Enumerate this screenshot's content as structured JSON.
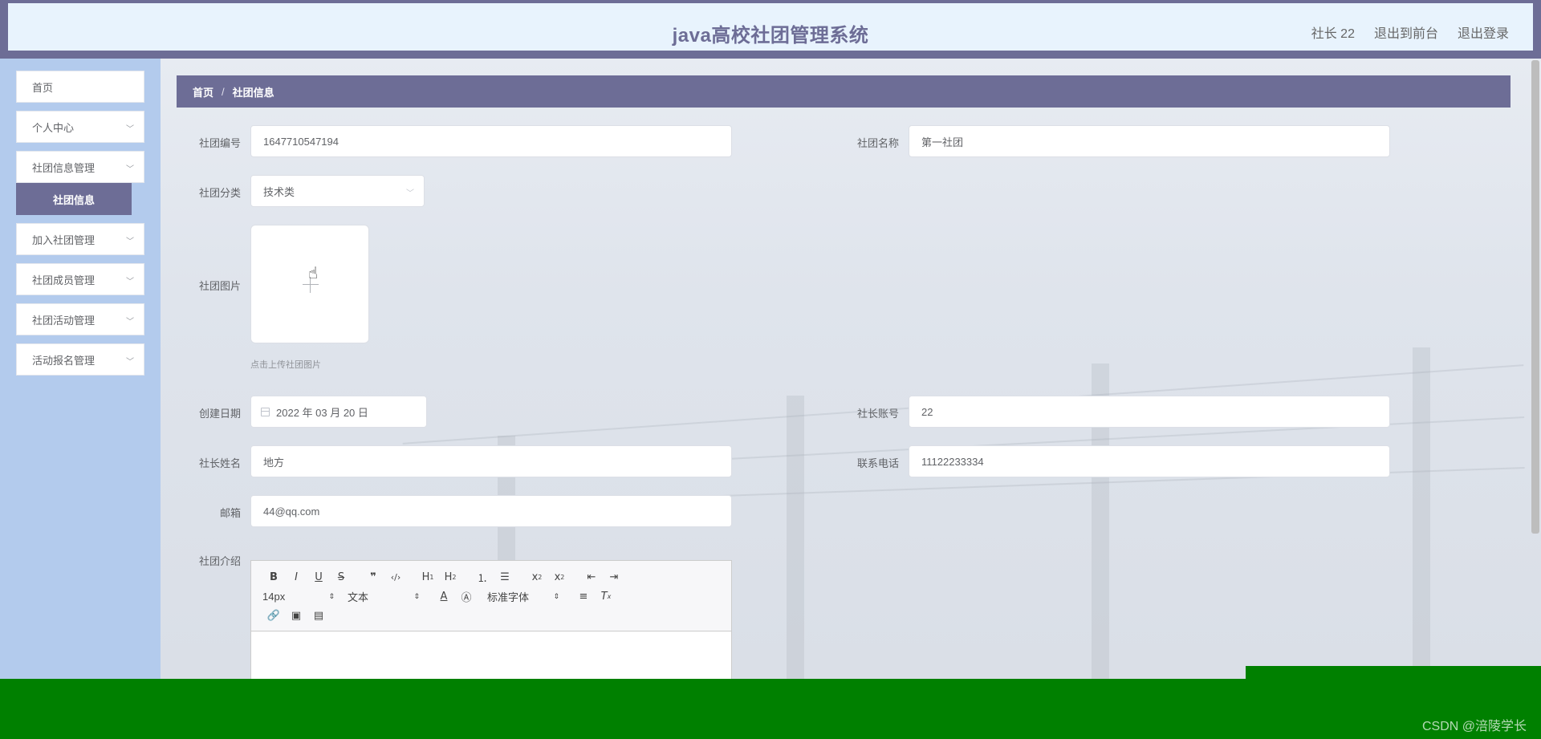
{
  "app": {
    "title": "java高校社团管理系统"
  },
  "header": {
    "user": "社长 22",
    "front_link": "退出到前台",
    "logout_link": "退出登录"
  },
  "sidebar": {
    "items": [
      {
        "label": "首页"
      },
      {
        "label": "个人中心"
      },
      {
        "label": "社团信息管理"
      },
      {
        "label": "社团信息",
        "active": true
      },
      {
        "label": "加入社团管理"
      },
      {
        "label": "社团成员管理"
      },
      {
        "label": "社团活动管理"
      },
      {
        "label": "活动报名管理"
      }
    ]
  },
  "breadcrumb": {
    "home": "首页",
    "separator": "/",
    "current": "社团信息"
  },
  "form": {
    "club_no": {
      "label": "社团编号",
      "value": "1647710547194"
    },
    "club_name": {
      "label": "社团名称",
      "value": "第一社团"
    },
    "club_category": {
      "label": "社团分类",
      "value": "技术类"
    },
    "club_image": {
      "label": "社团图片",
      "hint": "点击上传社团图片"
    },
    "created_date": {
      "label": "创建日期",
      "value": "2022 年 03 月 20 日"
    },
    "leader_account": {
      "label": "社长账号",
      "value": "22"
    },
    "leader_name": {
      "label": "社长姓名",
      "value": "地方"
    },
    "phone": {
      "label": "联系电话",
      "value": "11122233334"
    },
    "email": {
      "label": "邮箱",
      "value": "44@qq.com"
    },
    "intro": {
      "label": "社团介绍"
    }
  },
  "editor": {
    "font_size": "14px",
    "block_type": "文本",
    "font_family": "标准字体"
  },
  "watermark": "CSDN @涪陵学长",
  "colors": {
    "accent": "#6d6d96",
    "sidebar_bg": "#b3cbed",
    "header_bg": "#e8f3fd",
    "bottom_bar": "#008000"
  }
}
